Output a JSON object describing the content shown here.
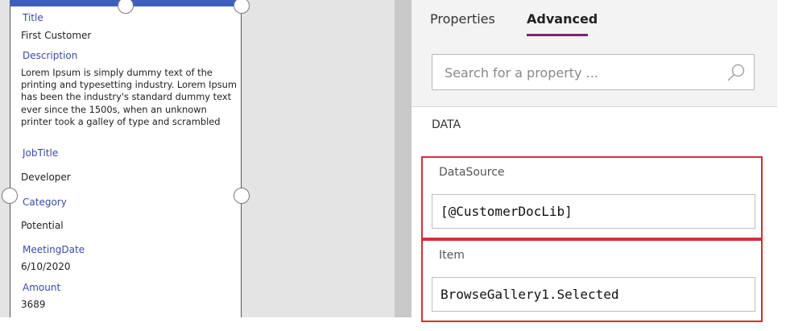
{
  "form": {
    "fields": [
      {
        "label": "Title",
        "value": "First Customer"
      },
      {
        "label": "Description",
        "value": "Lorem Ipsum is simply dummy text of the printing and typesetting industry. Lorem Ipsum has been the industry's standard dummy text ever since the 1500s, when an unknown printer took a galley of type and scrambled"
      },
      {
        "label": "JobTitle",
        "value": "Developer"
      },
      {
        "label": "Category",
        "value": "Potential"
      },
      {
        "label": "MeetingDate",
        "value": "6/10/2020"
      },
      {
        "label": "Amount",
        "value": "3689"
      }
    ]
  },
  "panel": {
    "tabs": [
      {
        "label": "Properties",
        "active": false
      },
      {
        "label": "Advanced",
        "active": true
      }
    ],
    "search": {
      "placeholder": "Search for a property ..."
    },
    "section_title": "DATA",
    "properties": [
      {
        "label": "DataSource",
        "value": "[@CustomerDocLib]"
      },
      {
        "label": "Item",
        "value": "BrowseGallery1.Selected"
      }
    ]
  },
  "colors": {
    "form_accent": "#3f5fbf",
    "field_label": "#3a4aa8",
    "tab_underline": "#742774",
    "highlight_border": "#d32f3a"
  }
}
